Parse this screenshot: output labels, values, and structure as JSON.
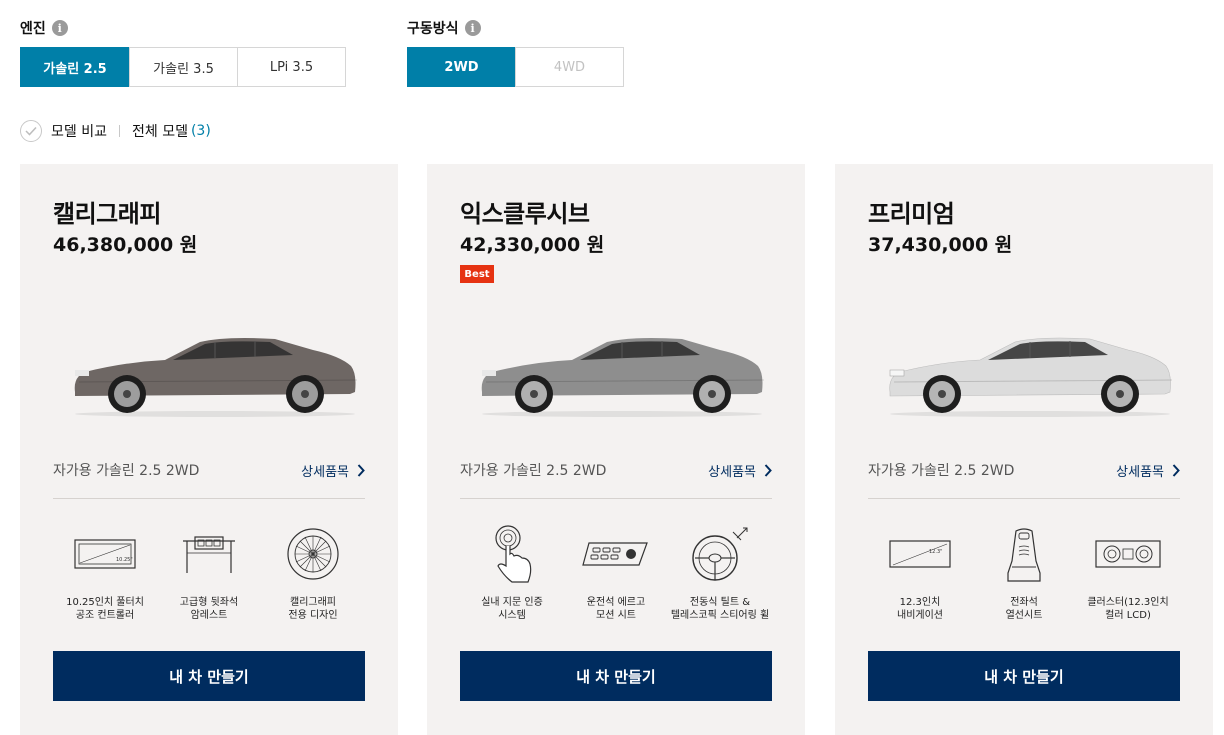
{
  "filters": {
    "engine": {
      "title": "엔진",
      "info_icon": "info-icon",
      "options": [
        "가솔린 2.5",
        "가솔린 3.5",
        "LPi 3.5"
      ],
      "selected": "가솔린 2.5"
    },
    "drive": {
      "title": "구동방식",
      "info_icon": "info-icon",
      "options": [
        "2WD",
        "4WD"
      ],
      "selected": "2WD"
    }
  },
  "compare": {
    "label": "모델 비교",
    "all_models_label": "전체 모델",
    "count": "(3)"
  },
  "colors": {
    "accent": "#007fa8",
    "navy": "#002c5f",
    "badge": "#e63312",
    "card_bg": "#f4f2f1"
  },
  "cards": [
    {
      "name": "캘리그래피",
      "price": "46,380,000 원",
      "badge": "",
      "car_color": "#6e6764",
      "spec": "자가용 가솔린 2.5 2WD",
      "detail_label": "상세품목",
      "features": [
        {
          "icon": "touchscreen-controller-icon",
          "label": "10.25인치 풀터치\n공조 컨트롤러"
        },
        {
          "icon": "rear-armrest-icon",
          "label": "고급형 뒷좌석\n암레스트"
        },
        {
          "icon": "wheel-design-icon",
          "label": "캘리그래피\n전용 디자인"
        }
      ],
      "cta": "내 차 만들기"
    },
    {
      "name": "익스클루시브",
      "price": "42,330,000 원",
      "badge": "Best",
      "car_color": "#8e8e8e",
      "spec": "자가용 가솔린 2.5 2WD",
      "detail_label": "상세품목",
      "features": [
        {
          "icon": "fingerprint-icon",
          "label": "실내 지문 인증\n시스템"
        },
        {
          "icon": "seat-control-icon",
          "label": "운전석 에르고\n모션 시트"
        },
        {
          "icon": "steering-wheel-icon",
          "label": "전동식 틸트 &\n텔레스코픽 스티어링 휠"
        }
      ],
      "cta": "내 차 만들기"
    },
    {
      "name": "프리미엄",
      "price": "37,430,000 원",
      "badge": "",
      "car_color": "#dcdcdc",
      "spec": "자가용 가솔린 2.5 2WD",
      "detail_label": "상세품목",
      "features": [
        {
          "icon": "navigation-screen-icon",
          "label": "12.3인치\n내비게이션"
        },
        {
          "icon": "heated-seat-icon",
          "label": "전좌석\n열선시트"
        },
        {
          "icon": "cluster-icon",
          "label": "클러스터(12.3인치\n컬러 LCD)"
        }
      ],
      "cta": "내 차 만들기"
    }
  ]
}
